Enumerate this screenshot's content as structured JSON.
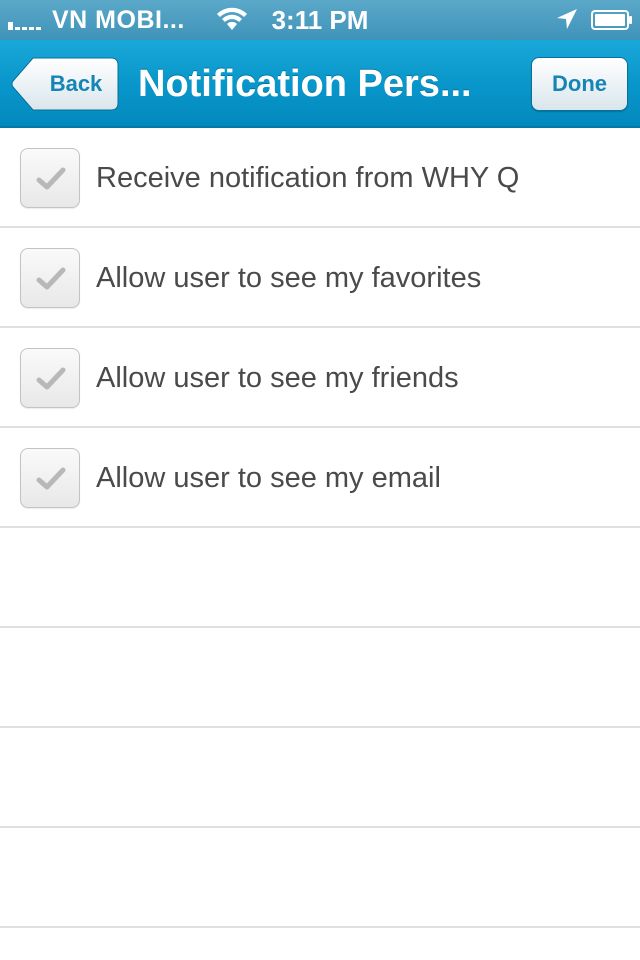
{
  "status_bar": {
    "carrier": "VN MOBI...",
    "time": "3:11 PM",
    "icons": [
      "signal-icon",
      "wifi-icon",
      "location-icon",
      "battery-icon"
    ]
  },
  "nav": {
    "back_label": "Back",
    "title": "Notification Pers...",
    "done_label": "Done"
  },
  "settings": [
    {
      "label": "Receive notification from WHY Q",
      "checked": true
    },
    {
      "label": "Allow user to see my favorites",
      "checked": true
    },
    {
      "label": "Allow user to see my friends",
      "checked": true
    },
    {
      "label": "Allow user to see my email",
      "checked": true
    }
  ],
  "colors": {
    "nav_bar": "#0997cb",
    "status_bar": "#4a9ec2",
    "button_text": "#1684b6",
    "row_text": "#4a4a4a",
    "separator": "#e0e0e0"
  }
}
